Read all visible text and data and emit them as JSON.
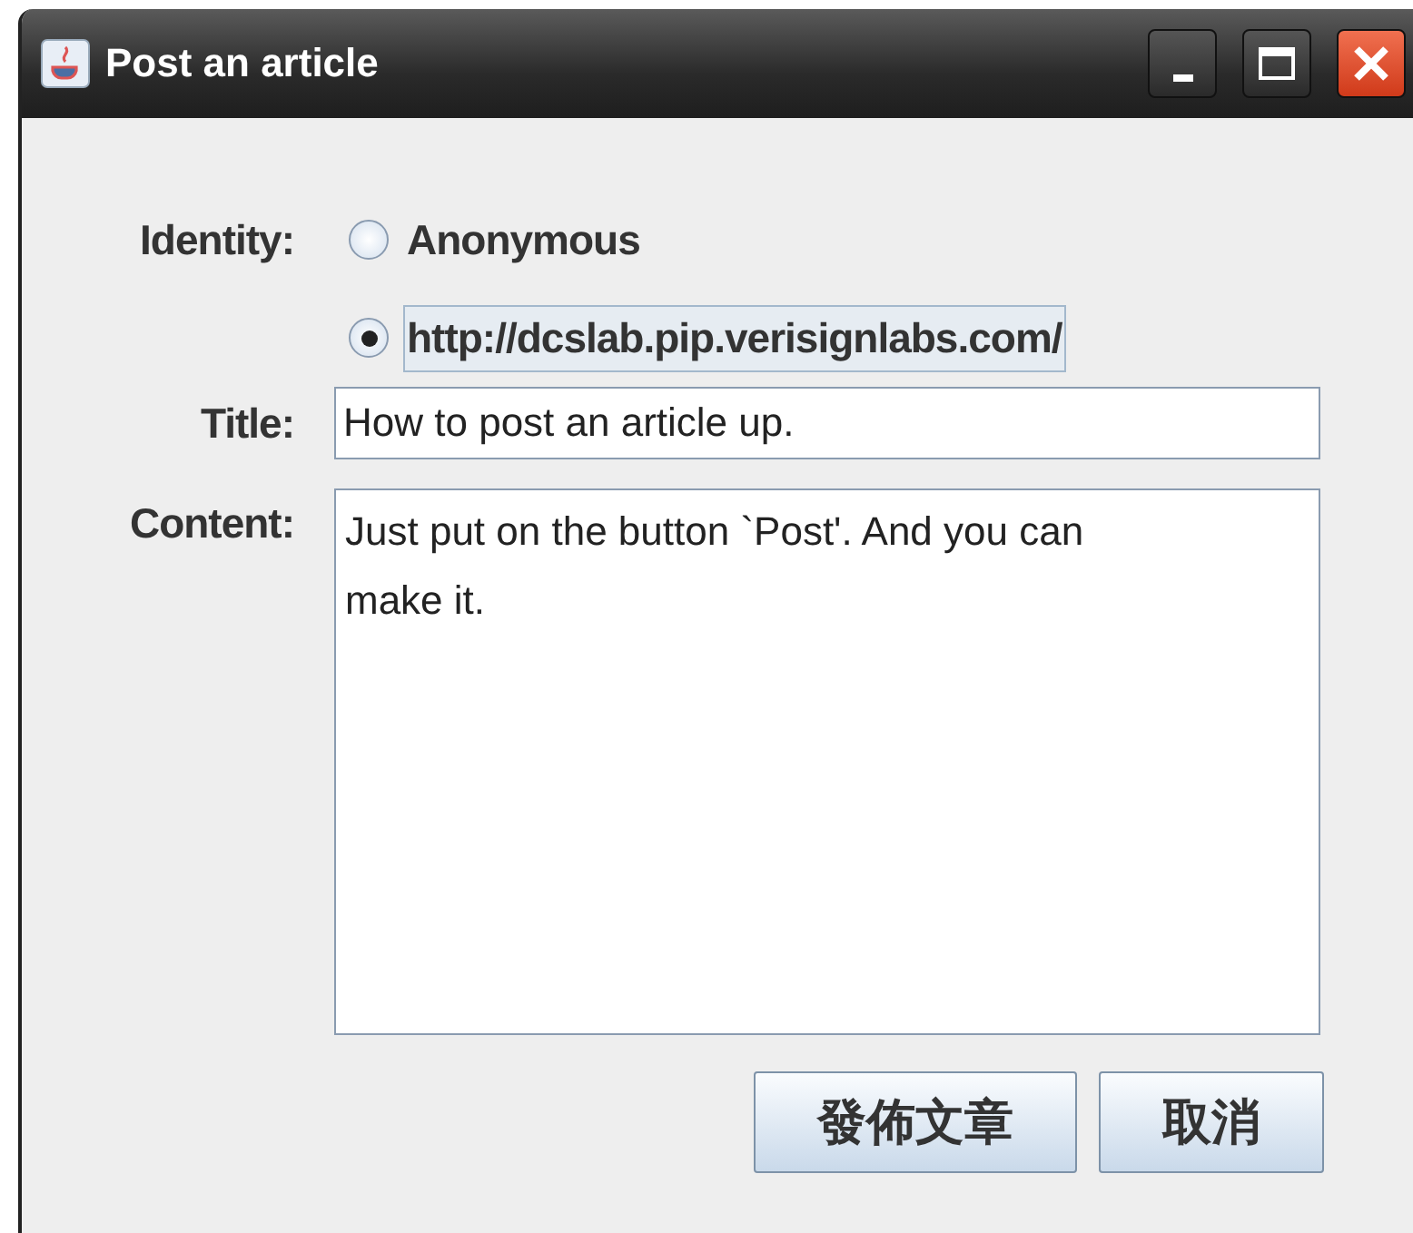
{
  "window": {
    "title": "Post an article"
  },
  "identity": {
    "label": "Identity:",
    "options": [
      {
        "label": "Anonymous",
        "selected": false
      },
      {
        "label": "http://dcslab.pip.verisignlabs.com/",
        "selected": true
      }
    ]
  },
  "title_field": {
    "label": "Title:",
    "value": "How to post an article up."
  },
  "content_field": {
    "label": "Content:",
    "value": "Just put on the button `Post'. And you can make it."
  },
  "buttons": [
    "發佈文章",
    "取消"
  ]
}
